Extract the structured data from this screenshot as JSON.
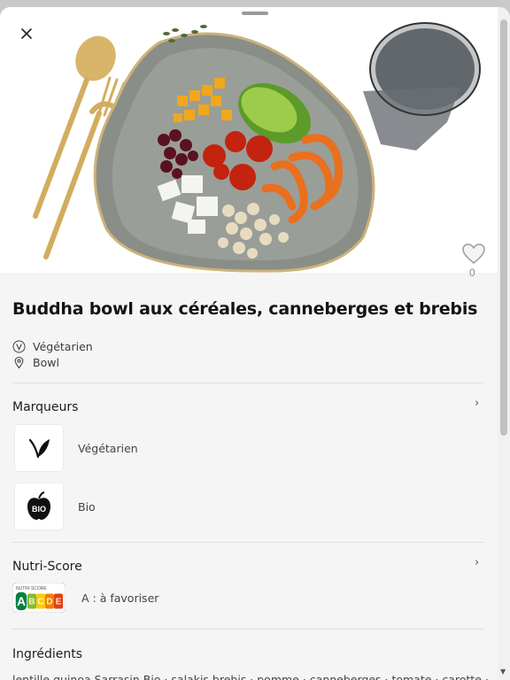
{
  "recipe": {
    "title": "Buddha bowl aux céréales, canneberges et brebis",
    "diet": "Végétarien",
    "category": "Bowl",
    "favorite_count": "0"
  },
  "markers": {
    "section_title": "Marqueurs",
    "items": [
      {
        "label": "Végétarien",
        "icon": "leaf-icon"
      },
      {
        "label": "Bio",
        "icon": "bio-apple-icon",
        "badge_text": "BIO"
      }
    ]
  },
  "nutriscore": {
    "section_title": "Nutri-Score",
    "logo_caption": "NUTRI-SCORE",
    "grades": [
      "A",
      "B",
      "C",
      "D",
      "E"
    ],
    "grade_colors": [
      "#038141",
      "#85bb2f",
      "#fecb02",
      "#ee8100",
      "#e63e11"
    ],
    "selected_grade": "A",
    "description": "A : à favoriser"
  },
  "ingredients": {
    "section_title": "Ingrédients",
    "text": "lentille quinoa Sarrasin Bio · salakis brebis · pomme · canneberges · tomate · carotte ·"
  },
  "icons": {
    "close": "close-icon",
    "favorite": "heart-icon",
    "diet": "vegetarian-v-icon",
    "category": "location-pin-icon",
    "chevron": "chevron-right-icon"
  }
}
